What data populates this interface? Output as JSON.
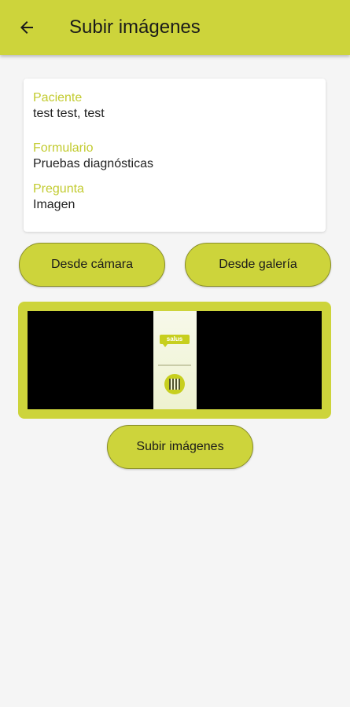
{
  "app_bar": {
    "title": "Subir imágenes",
    "back_icon": "arrow-left-icon",
    "color": "#cdd43b"
  },
  "info_card": {
    "fields": [
      {
        "label": "Paciente",
        "value": "test test, test"
      },
      {
        "label": "Formulario",
        "value": "Pruebas diagnósticas"
      },
      {
        "label": "Pregunta",
        "value": "Imagen"
      }
    ],
    "label_color": "#c2cb2f"
  },
  "actions": {
    "camera_label": "Desde cámara",
    "gallery_label": "Desde galería",
    "upload_label": "Subir imágenes"
  },
  "preview": {
    "logo_text": "salus"
  }
}
